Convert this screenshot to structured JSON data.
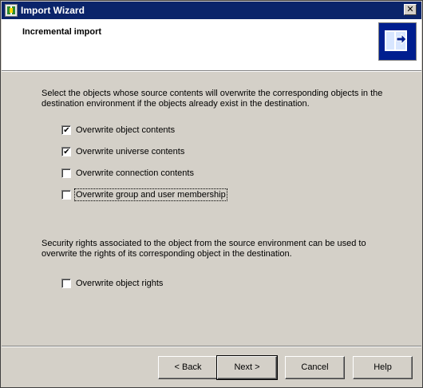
{
  "window": {
    "title": "Import Wizard",
    "close_symbol": "✕"
  },
  "header": {
    "title": "Incremental import",
    "icon": "import-wizard-logo-icon"
  },
  "content": {
    "intro": "Select the objects whose source contents will overwrite the corresponding objects in the destination environment if the objects already exist in the destination.",
    "options": [
      {
        "label": "Overwrite object contents",
        "checked": true
      },
      {
        "label": "Overwrite universe contents",
        "checked": true
      },
      {
        "label": "Overwrite connection contents",
        "checked": false
      },
      {
        "label": "Overwrite group and user membership",
        "checked": false
      }
    ],
    "security_text": "Security rights associated to the object from the source environment can be used to overwrite the rights of its corresponding object in the destination.",
    "rights_option": {
      "label": "Overwrite object rights",
      "checked": false
    }
  },
  "buttons": {
    "back": "< Back",
    "next": "Next >",
    "cancel": "Cancel",
    "help": "Help"
  }
}
